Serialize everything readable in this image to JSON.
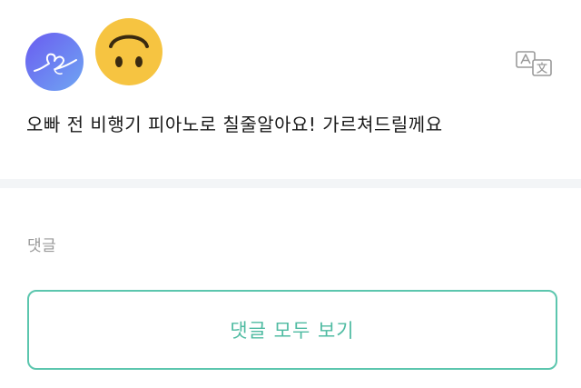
{
  "post": {
    "avatar_icon": "heart-signature-icon",
    "reaction_emoji": "upside-down-face-emoji",
    "translate_icon": "translate-icon",
    "text": "오빠 전 비행기 피아노로 칠줄알아요! 가르쳐드릴께요"
  },
  "comments": {
    "label": "댓글",
    "view_all_label": "댓글 모두 보기"
  },
  "colors": {
    "accent": "#5cc6ae",
    "avatar_gradient_start": "#6a5cf0",
    "avatar_gradient_end": "#6fa6f3",
    "emoji_yellow": "#f6c441",
    "text_primary": "#1a1a1a",
    "text_muted": "#9a9a9a",
    "divider": "#f3f5f7"
  }
}
